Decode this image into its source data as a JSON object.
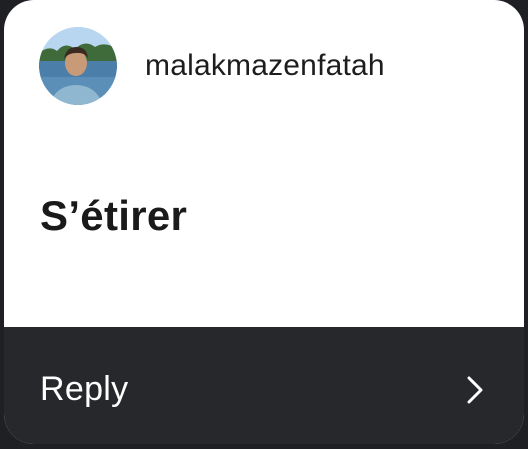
{
  "header": {
    "username": "malakmazenfatah",
    "avatar_icon": "avatar-photo"
  },
  "message": {
    "text": "S’étirer"
  },
  "reply": {
    "label": "Reply",
    "icon": "chevron-right-icon"
  },
  "colors": {
    "card_bg": "#ffffff",
    "reply_bar_bg": "#27282c",
    "page_bg": "#1f2023",
    "text_primary": "#1a1a1a",
    "reply_text": "#ffffff"
  }
}
